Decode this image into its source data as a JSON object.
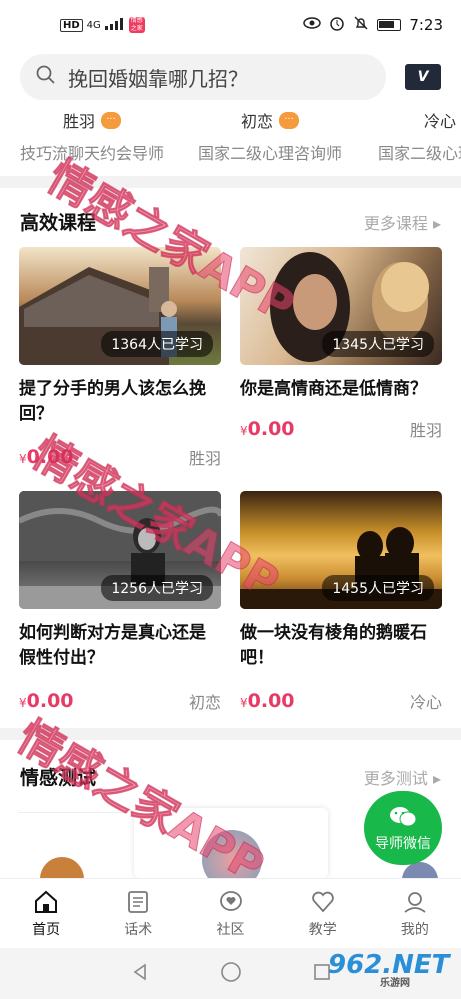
{
  "status_bar": {
    "hd": "HD",
    "network": "4G",
    "app_badge": "情感之家",
    "time": "7:23"
  },
  "search": {
    "placeholder": "挽回婚姻靠哪几招？",
    "vip_label": "V"
  },
  "mentors": [
    {
      "name": "胜羽",
      "title": "技巧流聊天约会导师"
    },
    {
      "name": "初恋",
      "title": "国家二级心理咨询师"
    },
    {
      "name": "冷心",
      "title": "国家二级心理咨询师"
    }
  ],
  "courses_section": {
    "title": "高效课程",
    "more": "更多课程 ▸"
  },
  "courses": [
    {
      "learners": "1364人已学习",
      "title": "提了分手的男人该怎么挽回？",
      "currency": "¥",
      "price": "0.00",
      "author": "胜羽"
    },
    {
      "learners": "1345人已学习",
      "title": "你是高情商还是低情商？",
      "currency": "¥",
      "price": "0.00",
      "author": "胜羽"
    },
    {
      "learners": "1256人已学习",
      "title": "如何判断对方是真心还是假性付出？",
      "currency": "¥",
      "price": "0.00",
      "author": "初恋"
    },
    {
      "learners": "1455人已学习",
      "title": "做一块没有棱角的鹅暖石吧！",
      "currency": "¥",
      "price": "0.00",
      "author": "冷心"
    }
  ],
  "tests_section": {
    "title": "情感测试",
    "more": "更多测试 ▸"
  },
  "wechat_button": {
    "label": "导师微信"
  },
  "tabs": [
    {
      "label": "首页",
      "icon": "home-icon"
    },
    {
      "label": "话术",
      "icon": "list-icon"
    },
    {
      "label": "社区",
      "icon": "heart-chat-icon"
    },
    {
      "label": "教学",
      "icon": "heart-icon"
    },
    {
      "label": "我的",
      "icon": "profile-icon"
    }
  ],
  "watermark": {
    "text": "情感之家APP"
  },
  "site_logo": {
    "text": "962.NET",
    "sub": "乐游网"
  },
  "colors": {
    "accent": "#e83a66",
    "wechat": "#19b84a"
  }
}
